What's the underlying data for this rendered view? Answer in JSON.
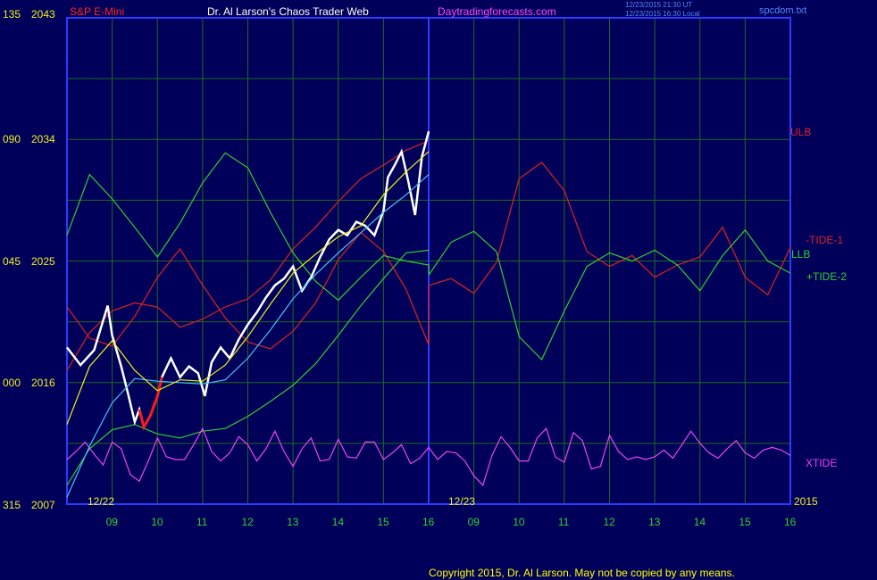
{
  "header": {
    "symbol": "S&P E-Mini",
    "site": "Dr. Al Larson's Chaos Trader Web",
    "url": "Daytradingforecasts.com",
    "timestamp_ut": "12/23/2015 21:30 UT",
    "timestamp_local": "12/23/2015 16:30 Local",
    "file": "spcdom.txt"
  },
  "footer": {
    "copyright": "Copyright 2015, Dr. Al Larson. May not be copied by any means."
  },
  "colors": {
    "background": "#00005a",
    "frame": "#2a3cff",
    "grid": "#1c6b1c",
    "price": "#ffffff",
    "down_bars": "#ff1a1a",
    "ulb": "#e02020",
    "llb": "#2fd02f",
    "tide1": "#e02020",
    "tide2": "#2fd02f",
    "xtide": "#ee44ee",
    "ma_fast": "#f0f020",
    "ma_slow": "#48c0ff",
    "axis_text": "#f0f020",
    "time_text": "#2fd02f"
  },
  "chart_data": {
    "type": "line",
    "y_left_labels": [
      "135",
      "090",
      "045",
      "000",
      "315"
    ],
    "y_right_labels": [
      "2043",
      "2034",
      "2025",
      "2016",
      "2007"
    ],
    "ylim": [
      2007,
      2043
    ],
    "x_ticks_day1": [
      "09",
      "10",
      "11",
      "12",
      "13",
      "14",
      "15",
      "16"
    ],
    "x_ticks_day2": [
      "09",
      "10",
      "11",
      "12",
      "13",
      "14",
      "15",
      "16"
    ],
    "date_labels": [
      "12/22",
      "12/23"
    ],
    "year_label": "2015",
    "series_labels": {
      "ulb": "ULB",
      "tide1": "-TIDE-1",
      "llb": "LLB",
      "tide2": "+TIDE-2",
      "xtide": "XTIDE"
    },
    "price": {
      "hours": [
        8.0,
        8.3,
        8.6,
        8.9,
        9.0,
        9.2,
        9.35,
        9.5,
        9.6,
        9.7,
        9.85,
        10.0,
        10.1,
        10.3,
        10.5,
        10.7,
        10.9,
        11.05,
        11.2,
        11.4,
        11.6,
        11.8,
        12.0,
        12.2,
        12.4,
        12.6,
        12.8,
        13.0,
        13.2,
        13.4,
        13.6,
        13.8,
        14.0,
        14.2,
        14.4,
        14.6,
        14.8,
        15.0,
        15.1,
        15.25,
        15.4,
        15.55,
        15.7,
        15.85,
        16.0
      ],
      "close": [
        2018.6,
        2017.3,
        2018.4,
        2021.7,
        2019.5,
        2017.2,
        2015.2,
        2013.1,
        2014.0,
        2012.7,
        2013.6,
        2015.0,
        2016.4,
        2017.8,
        2016.4,
        2017.2,
        2016.7,
        2015.0,
        2017.5,
        2018.6,
        2017.8,
        2019.2,
        2020.3,
        2021.2,
        2022.3,
        2023.2,
        2023.7,
        2024.6,
        2022.8,
        2023.8,
        2025.3,
        2026.6,
        2027.3,
        2026.9,
        2027.9,
        2027.6,
        2026.9,
        2028.7,
        2031.2,
        2032.1,
        2033.1,
        2030.9,
        2028.4,
        2032.7,
        2034.6
      ],
      "red_segment_hours": [
        9.6,
        10.2
      ]
    },
    "ma_fast": {
      "hours": [
        8.0,
        8.5,
        9.0,
        9.5,
        10.0,
        10.5,
        11.0,
        11.5,
        12.0,
        12.5,
        13.0,
        13.5,
        14.0,
        14.5,
        15.0,
        15.5,
        16.0
      ],
      "values": [
        2012.9,
        2017.2,
        2019.1,
        2016.9,
        2015.4,
        2016.2,
        2016.1,
        2017.3,
        2019.4,
        2021.8,
        2024.1,
        2025.5,
        2026.8,
        2027.6,
        2029.9,
        2031.6,
        2033.1
      ]
    },
    "ma_slow": {
      "hours": [
        8.0,
        8.5,
        9.0,
        9.5,
        10.0,
        10.5,
        11.0,
        11.5,
        12.0,
        12.5,
        13.0,
        13.5,
        14.0,
        14.5,
        15.0,
        15.5,
        16.0
      ],
      "values": [
        2007.5,
        2011.3,
        2014.5,
        2016.3,
        2016.1,
        2016.0,
        2015.9,
        2016.2,
        2017.8,
        2019.9,
        2022.2,
        2024.0,
        2025.6,
        2027.1,
        2028.6,
        2029.9,
        2031.4
      ]
    },
    "ulb": {
      "hours": [
        8.0,
        8.5,
        9.0,
        9.5,
        10.0,
        10.5,
        11.0,
        11.5,
        12.0,
        12.5,
        13.0,
        13.5,
        14.0,
        14.5,
        15.0,
        15.5,
        16.0
      ],
      "values": [
        2016.9,
        2019.7,
        2021.3,
        2021.9,
        2021.6,
        2020.1,
        2020.7,
        2021.6,
        2022.2,
        2023.6,
        2025.9,
        2027.5,
        2029.4,
        2031.1,
        2032.1,
        2033.2,
        2033.9
      ]
    },
    "llb": {
      "hours": [
        8.0,
        8.5,
        9.0,
        9.5,
        10.0,
        10.5,
        11.0,
        11.5,
        12.0,
        12.5,
        13.0,
        13.5,
        14.0,
        14.5,
        15.0,
        15.5,
        16.0
      ],
      "values": [
        2008.4,
        2011.1,
        2012.5,
        2012.9,
        2012.2,
        2011.9,
        2012.4,
        2012.6,
        2013.5,
        2014.6,
        2015.8,
        2017.4,
        2019.5,
        2021.7,
        2023.7,
        2025.6,
        2025.8
      ]
    },
    "tide1": {
      "hours": [
        8.0,
        8.5,
        9.0,
        9.5,
        10.0,
        10.5,
        11.0,
        11.5,
        12.0,
        12.5,
        13.0,
        13.5,
        14.0,
        14.5,
        15.0,
        15.5,
        16.0,
        16.01,
        16.5,
        17.0,
        17.5,
        18.0,
        18.5,
        19.0,
        19.5,
        20.0,
        20.5,
        21.0,
        21.5,
        22.0,
        22.5,
        23.0,
        23.5,
        24.0
      ],
      "values": [
        2021.6,
        2019.3,
        2018.7,
        2020.9,
        2023.8,
        2025.9,
        2023.2,
        2020.8,
        2019.0,
        2018.5,
        2019.8,
        2021.9,
        2025.1,
        2027.1,
        2025.7,
        2022.9,
        2018.8,
        2023.2,
        2023.7,
        2022.6,
        2024.9,
        2031.1,
        2032.3,
        2030.2,
        2025.7,
        2024.6,
        2025.4,
        2023.8,
        2024.7,
        2025.3,
        2027.5,
        2023.8,
        2022.5,
        2026.0
      ]
    },
    "tide2": {
      "hours": [
        8.0,
        8.5,
        9.0,
        9.5,
        10.0,
        10.5,
        11.0,
        11.5,
        12.0,
        12.5,
        13.0,
        13.5,
        14.0,
        14.5,
        15.0,
        15.5,
        16.0,
        16.01,
        16.5,
        17.0,
        17.5,
        18.0,
        18.5,
        19.0,
        19.5,
        20.0,
        20.5,
        21.0,
        21.5,
        22.0,
        22.5,
        23.0,
        23.5,
        24.0
      ],
      "values": [
        2026.9,
        2031.4,
        2029.6,
        2027.5,
        2025.3,
        2027.8,
        2030.8,
        2033.0,
        2031.9,
        2028.6,
        2025.6,
        2023.5,
        2022.1,
        2023.8,
        2025.4,
        2025.0,
        2024.7,
        2024.0,
        2026.4,
        2027.2,
        2025.7,
        2019.4,
        2017.7,
        2021.3,
        2024.6,
        2025.6,
        2025.0,
        2025.8,
        2024.7,
        2022.8,
        2025.4,
        2027.3,
        2025.0,
        2024.1
      ]
    },
    "xtide": {
      "hours": [
        8.0,
        8.2,
        8.4,
        8.6,
        8.8,
        9.0,
        9.2,
        9.4,
        9.6,
        9.8,
        10.0,
        10.2,
        10.4,
        10.6,
        10.8,
        11.0,
        11.2,
        11.4,
        11.6,
        11.8,
        12.0,
        12.2,
        12.4,
        12.6,
        12.8,
        13.0,
        13.2,
        13.4,
        13.6,
        13.8,
        14.0,
        14.2,
        14.4,
        14.6,
        14.8,
        15.0,
        15.2,
        15.4,
        15.6,
        15.8,
        16.0,
        16.2,
        16.4,
        16.6,
        16.8,
        17.0,
        17.2,
        17.4,
        17.6,
        17.8,
        18.0,
        18.2,
        18.4,
        18.6,
        18.8,
        19.0,
        19.2,
        19.4,
        19.6,
        19.8,
        20.0,
        20.2,
        20.4,
        20.6,
        20.8,
        21.0,
        21.2,
        21.4,
        21.6,
        21.8,
        22.0,
        22.2,
        22.4,
        22.6,
        22.8,
        23.0,
        23.2,
        23.4,
        23.6,
        23.8,
        24.0
      ],
      "values": [
        2010.3,
        2010.9,
        2011.6,
        2010.7,
        2009.9,
        2011.6,
        2011.1,
        2009.2,
        2008.7,
        2010.2,
        2011.9,
        2010.5,
        2010.3,
        2010.3,
        2011.4,
        2012.6,
        2010.9,
        2010.2,
        2010.8,
        2012.0,
        2011.4,
        2010.2,
        2011.1,
        2012.4,
        2010.9,
        2009.8,
        2011.1,
        2011.9,
        2010.2,
        2010.3,
        2011.8,
        2010.5,
        2010.4,
        2011.6,
        2011.6,
        2010.3,
        2010.8,
        2011.4,
        2010.0,
        2010.4,
        2011.2,
        2010.3,
        2010.9,
        2010.8,
        2010.2,
        2009.1,
        2008.4,
        2010.6,
        2012.0,
        2011.2,
        2010.2,
        2010.2,
        2011.9,
        2012.6,
        2010.5,
        2010.1,
        2012.3,
        2011.7,
        2009.6,
        2009.8,
        2012.1,
        2010.9,
        2010.3,
        2010.5,
        2010.3,
        2010.5,
        2011.0,
        2010.4,
        2011.4,
        2012.4,
        2011.5,
        2010.8,
        2010.4,
        2011.1,
        2011.7,
        2010.8,
        2010.4,
        2011.0,
        2011.2,
        2011.0,
        2010.6
      ]
    }
  }
}
